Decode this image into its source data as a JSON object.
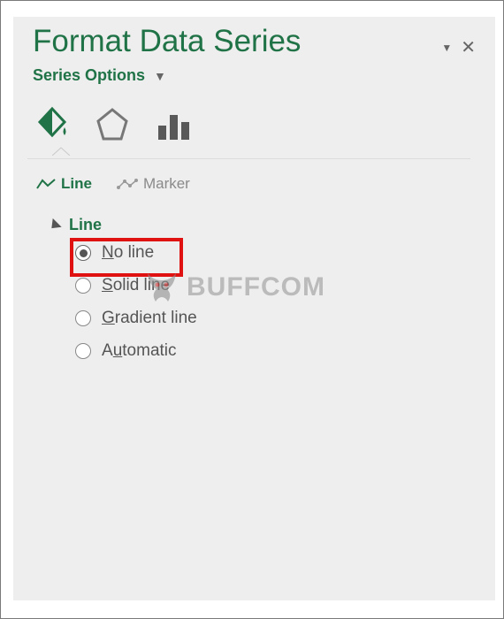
{
  "pane": {
    "title": "Format Data Series",
    "subhead": "Series Options"
  },
  "iconbar": {
    "fill_icon": "fill-line-icon",
    "effects_icon": "effects-icon",
    "series_icon": "series-options-icon"
  },
  "tabs": {
    "line": "Line",
    "marker": "Marker"
  },
  "section": {
    "line": "Line"
  },
  "radios": {
    "no_line_pre": "N",
    "no_line_post": "o line",
    "solid_pre": "S",
    "solid_post": "olid line",
    "gradient_pre": "G",
    "gradient_post": "radient line",
    "auto_pre": "A",
    "auto_mid": "u",
    "auto_post": "tomatic"
  },
  "watermark": {
    "text": "BUFFCOM"
  }
}
